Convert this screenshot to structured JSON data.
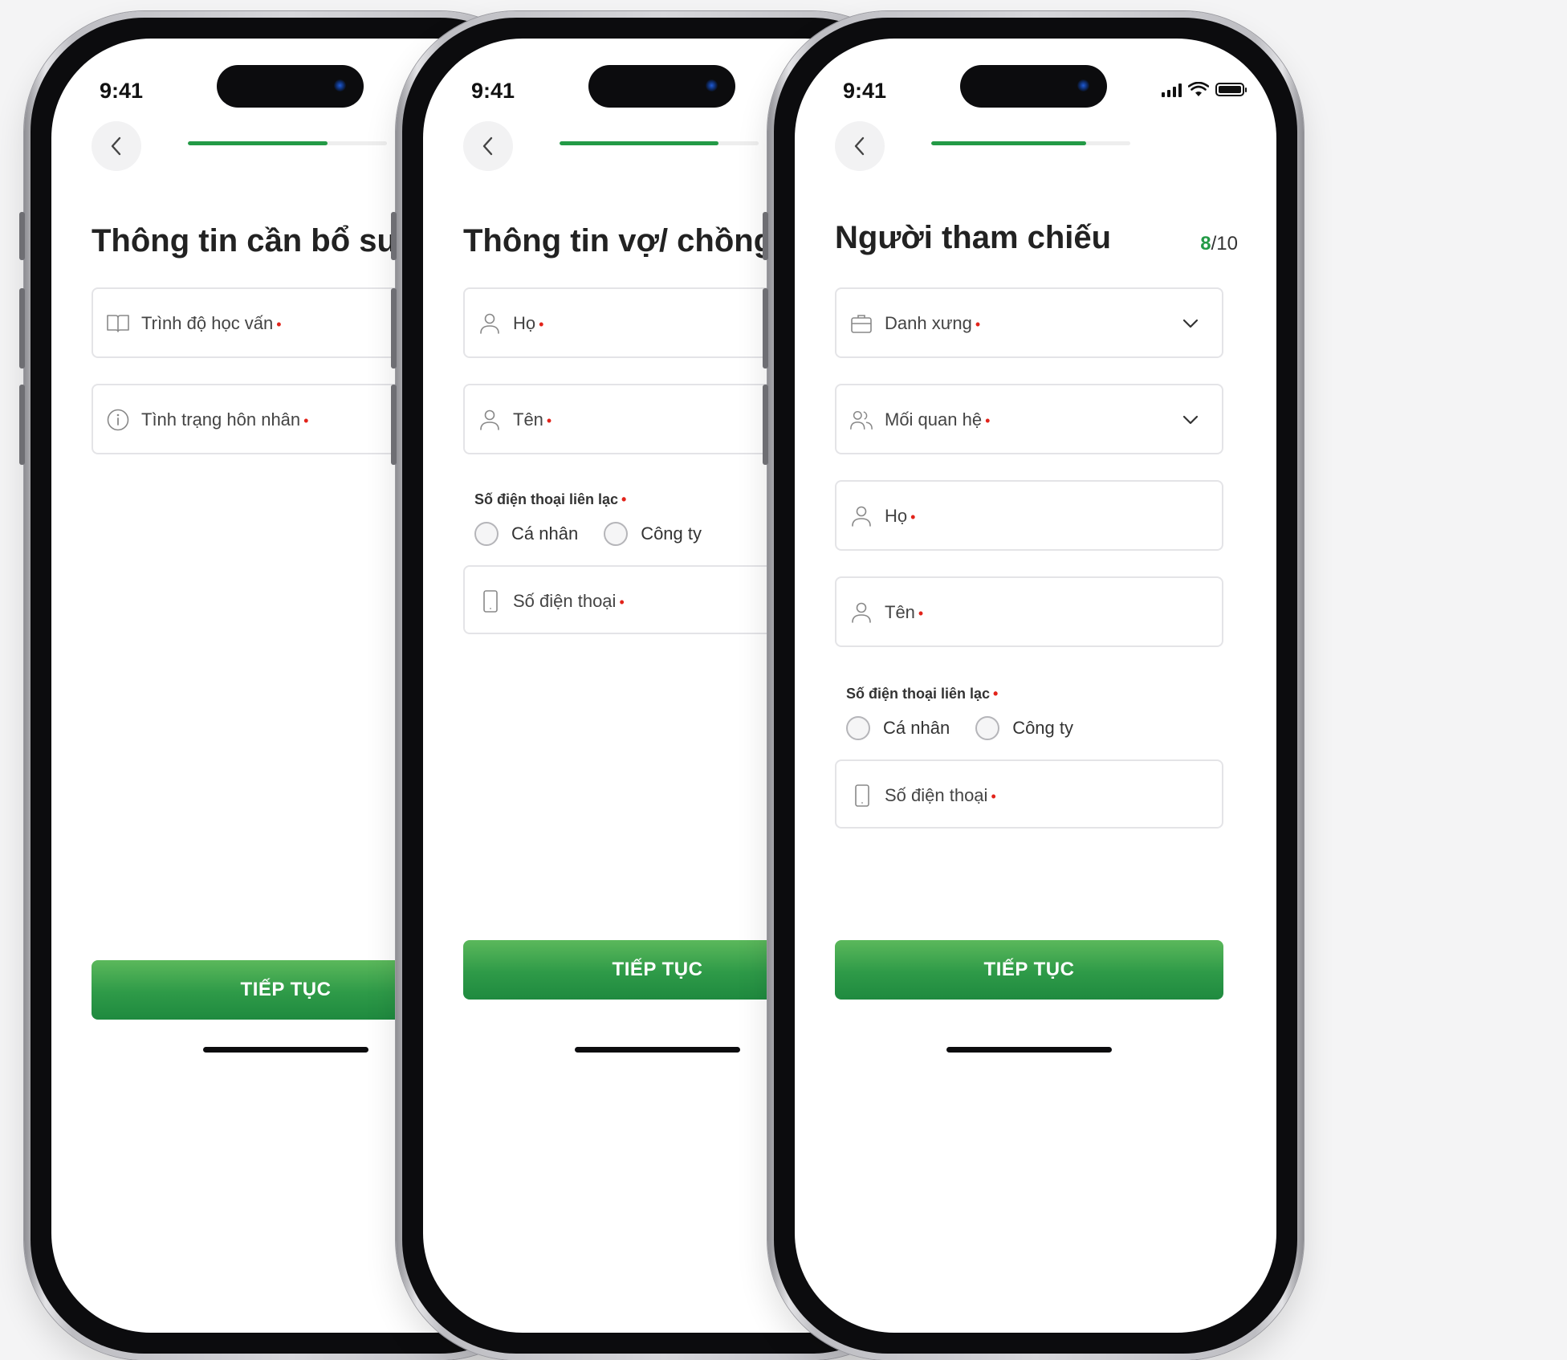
{
  "status_time": "9:41",
  "brand_color": "#239a46",
  "required_mark": "•",
  "screens": [
    {
      "title": "Thông tin cần bổ sung",
      "progress": 0.7,
      "fields": [
        {
          "icon": "book-icon",
          "label": "Trình độ học vấn"
        },
        {
          "icon": "info-icon",
          "label": "Tình trạng hôn nhân"
        }
      ],
      "cta": "TIẾP TỤC"
    },
    {
      "title": "Thông tin vợ/ chồng",
      "progress": 0.8,
      "fields": [
        {
          "icon": "user-icon",
          "label": "Họ"
        },
        {
          "icon": "user-icon",
          "label": "Tên"
        }
      ],
      "phone_section": {
        "label": "Số điện thoại liên lạc",
        "options": [
          "Cá nhân",
          "Công ty"
        ],
        "phone_field": "Số điện thoại"
      },
      "cta": "TIẾP TỤC"
    },
    {
      "title": "Người tham chiếu",
      "step_current": "8",
      "step_total": "/10",
      "progress": 0.78,
      "fields": [
        {
          "icon": "briefcase-icon",
          "label": "Danh xưng"
        },
        {
          "icon": "users-icon",
          "label": "Mối quan hệ"
        },
        {
          "icon": "user-icon",
          "label": "Họ"
        },
        {
          "icon": "user-icon",
          "label": "Tên"
        }
      ],
      "phone_section": {
        "label": "Số điện thoại liên lạc",
        "options": [
          "Cá nhân",
          "Công ty"
        ],
        "phone_field": "Số điện thoại"
      },
      "cta": "TIẾP TỤC"
    }
  ]
}
